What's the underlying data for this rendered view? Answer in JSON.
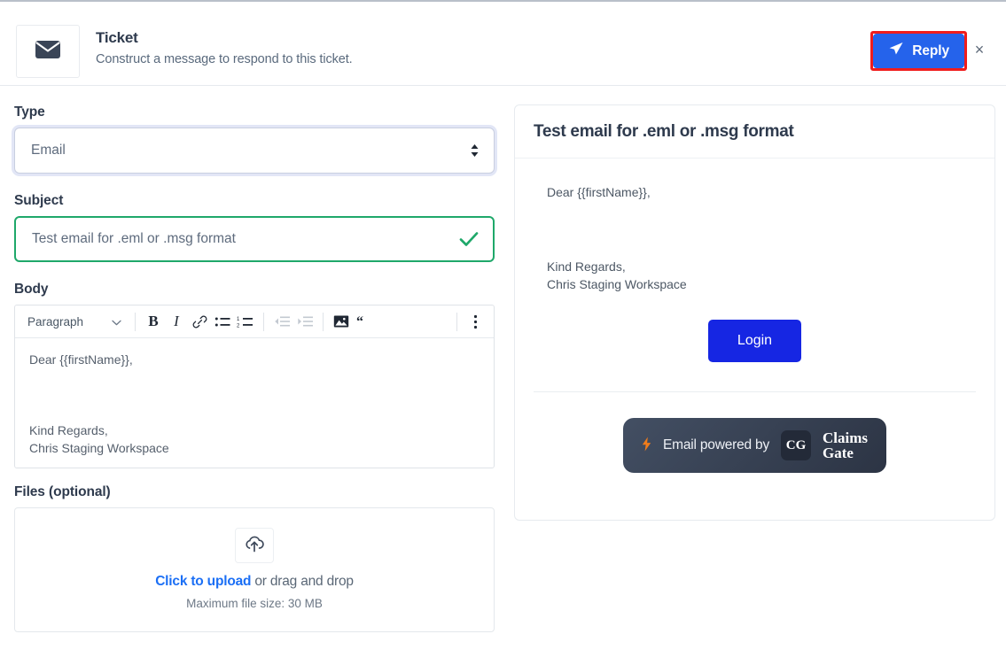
{
  "header": {
    "icon": "envelope-icon",
    "title": "Ticket",
    "subtitle": "Construct a message to respond to this ticket.",
    "reply_label": "Reply",
    "reply_icon": "paper-plane-icon",
    "close_label": "×",
    "accent_color": "#2563eb",
    "annotation_color": "#f01c1c"
  },
  "form": {
    "type": {
      "label": "Type",
      "value": "Email",
      "options": [
        "Email"
      ]
    },
    "subject": {
      "label": "Subject",
      "value": "Test email for .eml or .msg format",
      "valid": true,
      "valid_color": "#1fa86a"
    },
    "body": {
      "label": "Body",
      "block_format": "Paragraph",
      "toolbar": [
        {
          "name": "bold-button",
          "glyph": "B",
          "disabled": false
        },
        {
          "name": "italic-button",
          "glyph": "I",
          "disabled": false
        },
        {
          "name": "link-button",
          "glyph": "link",
          "disabled": false
        },
        {
          "name": "bullet-list-button",
          "glyph": "bullets",
          "disabled": false
        },
        {
          "name": "numbered-list-button",
          "glyph": "numbers",
          "disabled": false
        },
        {
          "name": "outdent-button",
          "glyph": "outdent",
          "disabled": true
        },
        {
          "name": "indent-button",
          "glyph": "indent",
          "disabled": true
        },
        {
          "name": "image-button",
          "glyph": "image",
          "disabled": false
        },
        {
          "name": "blockquote-button",
          "glyph": "quote",
          "disabled": false
        },
        {
          "name": "overflow-menu-button",
          "glyph": "dots",
          "disabled": false
        }
      ],
      "content": "Dear {{firstName}},\n\n\n\nKind Regards,\nChris Staging Workspace"
    },
    "files": {
      "label": "Files (optional)",
      "upload_link": "Click to upload",
      "upload_rest": " or drag and drop",
      "max_size": "Maximum file size: 30 MB",
      "link_color": "#1b6ff5"
    }
  },
  "preview": {
    "title": "Test email for .eml or .msg format",
    "greeting": "Dear {{firstName}},",
    "signoff": "Kind Regards,\nChris Staging Workspace",
    "cta_label": "Login",
    "cta_color": "#1626e3",
    "branding": {
      "bolt": "⚡",
      "text": "Email powered by",
      "logo_mark": "CG",
      "logo_line1": "Claims",
      "logo_line2": "Gate",
      "bolt_color": "#f07c1b"
    }
  }
}
